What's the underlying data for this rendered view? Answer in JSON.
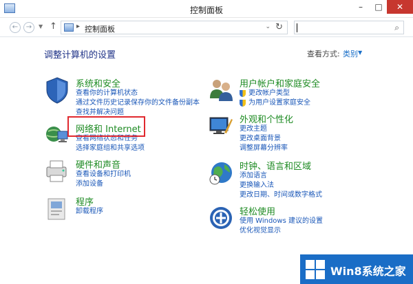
{
  "window": {
    "title": "控制面板"
  },
  "address": {
    "crumb": "控制面板"
  },
  "main": {
    "title": "调整计算机的设置",
    "view_by_label": "查看方式:",
    "view_by_value": "类别"
  },
  "categories": [
    {
      "heading": "系统和安全",
      "links": [
        "查看你的计算机状态",
        "通过文件历史记录保存你的文件备份副本",
        "查找并解决问题"
      ]
    },
    {
      "heading": "网络和 Internet",
      "links": [
        "查看网络状态和任务",
        "选择家庭组和共享选项"
      ]
    },
    {
      "heading": "硬件和声音",
      "links": [
        "查看设备和打印机",
        "添加设备"
      ]
    },
    {
      "heading": "程序",
      "links": [
        "卸载程序"
      ]
    },
    {
      "heading": "用户帐户和家庭安全",
      "links": [
        "更改帐户类型",
        "为用户设置家庭安全"
      ]
    },
    {
      "heading": "外观和个性化",
      "links": [
        "更改主题",
        "更改桌面背景",
        "调整屏幕分辨率"
      ]
    },
    {
      "heading": "时钟、语言和区域",
      "links": [
        "添加语言",
        "更换输入法",
        "更改日期、时间或数字格式"
      ]
    },
    {
      "heading": "轻松使用",
      "links": [
        "使用 Windows 建议的设置",
        "优化视觉显示"
      ]
    }
  ],
  "watermark": {
    "text": "Win8系统之家"
  },
  "colors": {
    "heading_green": "#1e8b23",
    "link_blue": "#1a57b8",
    "close_red": "#c7372f",
    "highlight_red": "#e0282e"
  }
}
